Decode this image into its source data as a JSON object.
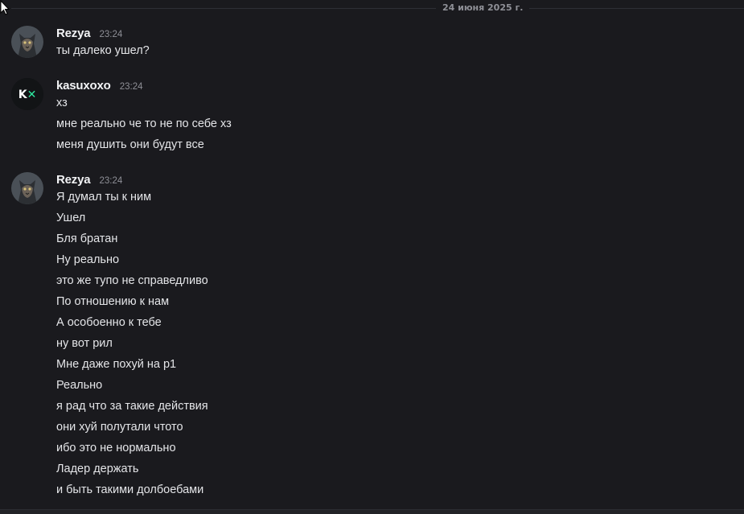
{
  "date_divider": "24 июня 2025 г.",
  "messages": [
    {
      "author": "Rezya",
      "time": "23:24",
      "avatar_icon": "cat-avatar-icon",
      "lines": [
        "ты далеко ушел?"
      ]
    },
    {
      "author": "kasuxoxo",
      "time": "23:24",
      "avatar_icon": "kx-logo-avatar-icon",
      "avatar_text": "K✕",
      "lines": [
        "хз",
        "мне реально че то не по себе хз",
        "меня душить они будут все"
      ]
    },
    {
      "author": "Rezya",
      "time": "23:24",
      "avatar_icon": "cat-avatar-icon",
      "lines": [
        "Я думал ты к ним",
        "Ушел",
        "Бля братан",
        "Ну реально",
        "это же тупо не справедливо",
        "По отношению к нам",
        "А особоенно к тебе",
        "ну вот рил",
        "Мне даже похуй на р1",
        "Реально",
        "я рад что за такие действия",
        "они хуй полутали чтото",
        "ибо это не нормально",
        "Ладер держать",
        "и быть такими долбоебами"
      ]
    }
  ],
  "colors": {
    "background": "#1a1a1e",
    "username": "#f2f3f5",
    "message_text": "#e4e5e8",
    "timestamp": "#8e8f96",
    "kx_accent": "#2ee8a0"
  }
}
